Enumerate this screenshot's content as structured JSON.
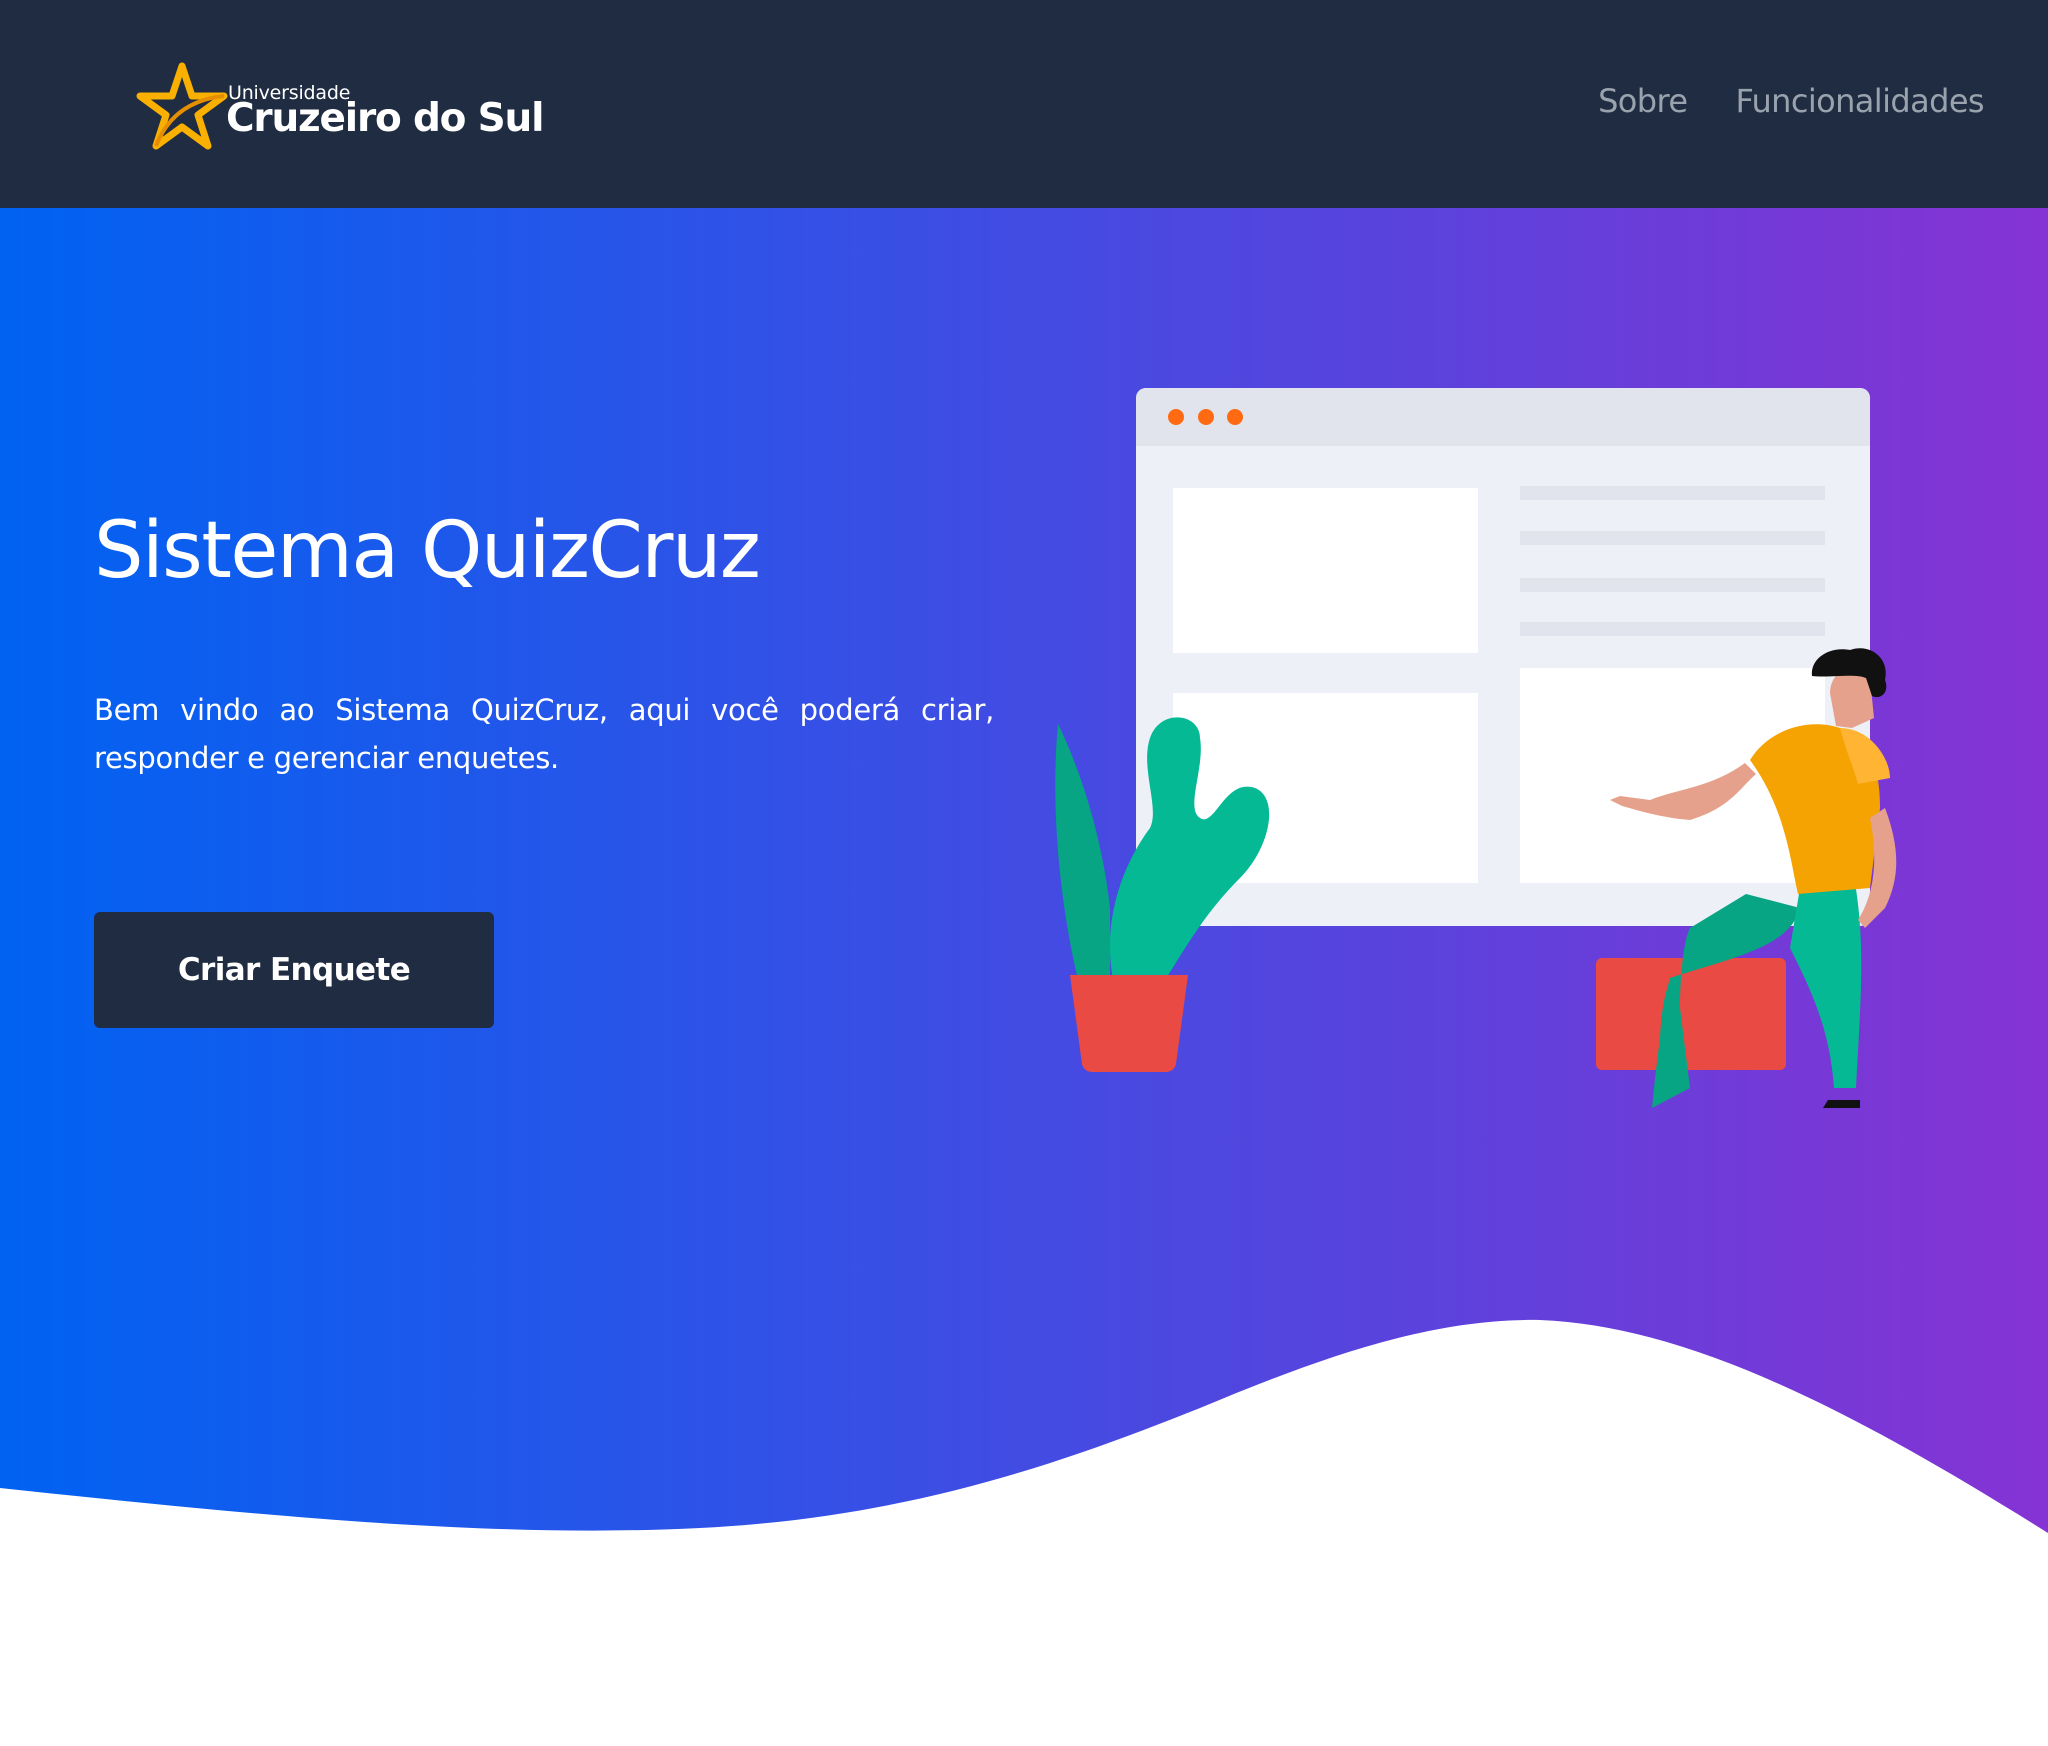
{
  "navbar": {
    "logo": {
      "small_text": "Universidade",
      "big_text": "Cruzeiro do Sul",
      "star_color": "#f9b000"
    },
    "links": [
      {
        "label": "Sobre"
      },
      {
        "label": "Funcionalidades"
      }
    ],
    "background": "#1f2c41"
  },
  "hero": {
    "title": "Sistema QuizCruz",
    "description": "Bem vindo ao Sistema QuizCruz, aqui você poderá criar, responder e gerenciar enquetes.",
    "cta_label": "Criar Enquete",
    "gradient": [
      "#0062f2",
      "#8633d4"
    ]
  },
  "illustration": {
    "window_dots_color": "#ff6a13",
    "shirt_color": "#f5a302",
    "pants_color": "#04b994",
    "box_color": "#e94a43",
    "plant_color": "#07b38a"
  }
}
